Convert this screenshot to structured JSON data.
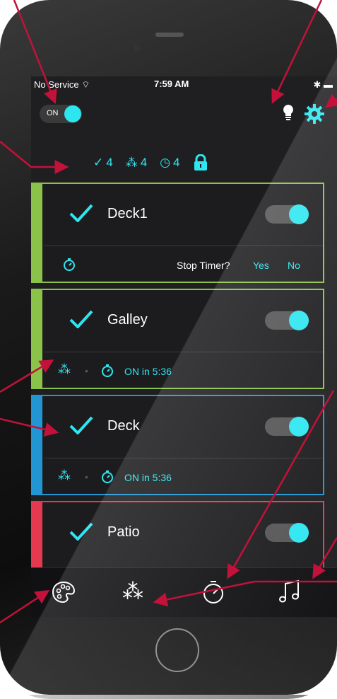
{
  "status": {
    "carrier": "No Service",
    "time": "7:59 AM"
  },
  "master": {
    "label": "ON"
  },
  "summary": {
    "checked": "4",
    "scenes": "4",
    "timers": "4"
  },
  "cards": [
    {
      "name": "Deck1",
      "color": "#8bc34a",
      "row2": {
        "prompt": "Stop Timer?",
        "yes": "Yes",
        "no": "No"
      }
    },
    {
      "name": "Galley",
      "color": "#8bc34a",
      "row2": {
        "status": "ON in 5:36"
      }
    },
    {
      "name": "Deck",
      "color": "#2196d3",
      "row2": {
        "status": "ON in 5:36"
      }
    },
    {
      "name": "Patio",
      "color": "#e53950"
    }
  ],
  "tabs": [
    "palette-icon",
    "scenes-icon",
    "timer-icon",
    "music-icon"
  ],
  "colors": {
    "accent": "#2ee6f0",
    "arrow": "#c2123a"
  }
}
